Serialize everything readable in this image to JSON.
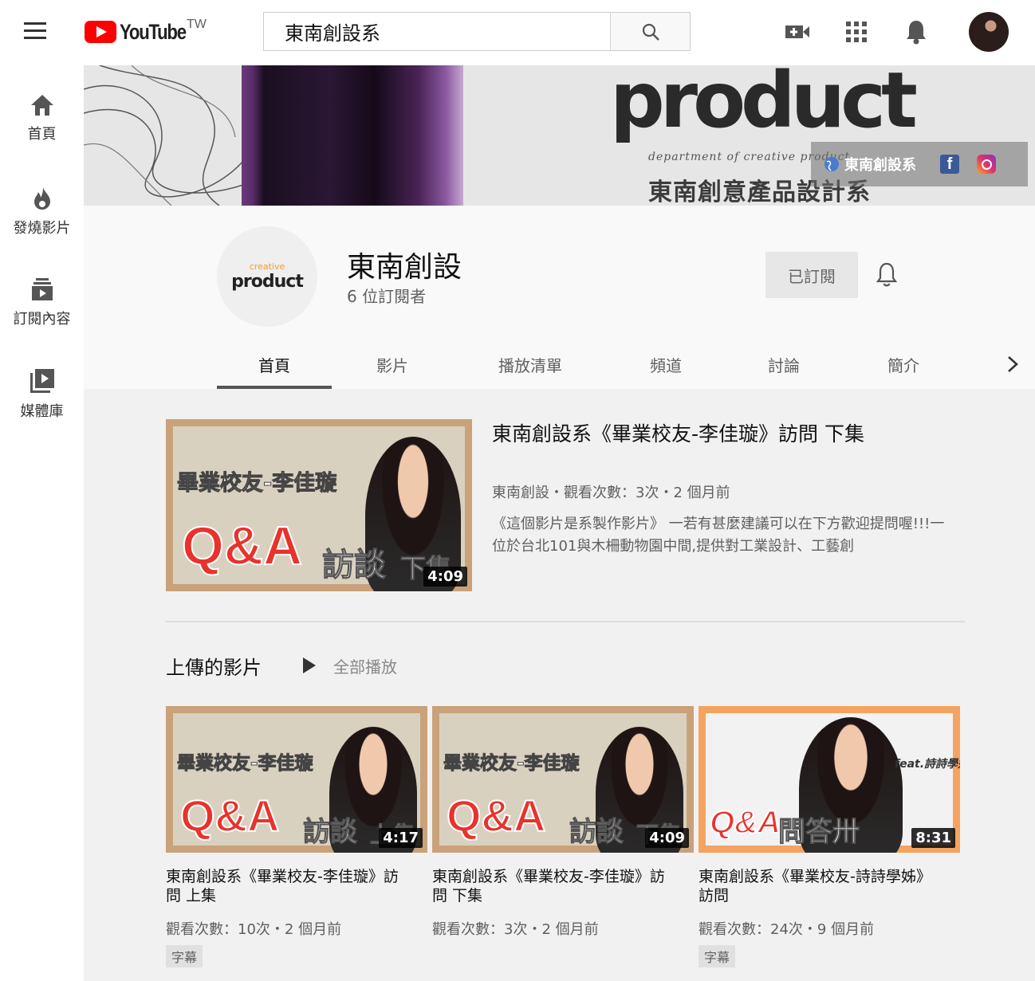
{
  "header": {
    "logo_text": "YouTube",
    "logo_region": "TW",
    "search_value": "東南創設系",
    "icons": [
      "menu-icon",
      "search-icon",
      "video-camera-icon",
      "apps-grid-icon",
      "bell-icon"
    ]
  },
  "sidebar": {
    "items": [
      {
        "label": "首頁",
        "icon": "home-icon"
      },
      {
        "label": "發燒影片",
        "icon": "flame-icon"
      },
      {
        "label": "訂閱內容",
        "icon": "subscriptions-icon"
      },
      {
        "label": "媒體庫",
        "icon": "library-icon"
      }
    ]
  },
  "banner": {
    "wordmark": "product",
    "subtitle": "department of creative product",
    "chinese_name": "東南創意產品設計系",
    "link_text": "東南創設系"
  },
  "channel": {
    "avatar_small": "creative",
    "avatar_word": "product",
    "name": "東南創設",
    "subscribers": "6 位訂閱者",
    "subscribe_label": "已訂閱"
  },
  "tabs": [
    "首頁",
    "影片",
    "播放清單",
    "頻道",
    "討論",
    "簡介"
  ],
  "featured": {
    "thumb_caption": "畢業校友-李佳璇",
    "thumb_qa": "Q&A",
    "thumb_talk": "訪談",
    "thumb_part": "下集",
    "duration": "4:09",
    "title": "東南創設系《畢業校友-李佳璇》訪問 下集",
    "meta": "東南創設・觀看次數：3次・2 個月前",
    "description": "《這個影片是系製作影片》 一若有甚麼建議可以在下方歡迎提問喔!!!一 位於台北101與木柵動物園中間,提供對工業設計、工藝創"
  },
  "shelf": {
    "title": "上傳的影片",
    "play_all": "全部播放",
    "videos": [
      {
        "caption": "畢業校友-李佳璇",
        "qa": "Q&A",
        "talk": "訪談",
        "part": "上集",
        "duration": "4:17",
        "title": "東南創設系《畢業校友-李佳璇》訪問 上集",
        "meta": "觀看次數：10次・2 個月前",
        "badge": "字幕"
      },
      {
        "caption": "畢業校友-李佳璇",
        "qa": "Q&A",
        "talk": "訪談",
        "part": "下集",
        "duration": "4:09",
        "title": "東南創設系《畢業校友-李佳璇》訪問 下集",
        "meta": "觀看次數：3次・2 個月前",
        "badge": ""
      },
      {
        "caption": "feat.詩詩學姊",
        "qa": "Q&A",
        "talk": "問答卅",
        "part": "",
        "duration": "8:31",
        "title": "東南創設系《畢業校友-詩詩學姊》訪問",
        "meta": "觀看次數：24次・9 個月前",
        "badge": "字幕"
      }
    ]
  },
  "colors": {
    "brand": "#ff0000",
    "orange_frame": "#f4a460",
    "thumb_frame": "#c9a27a"
  }
}
